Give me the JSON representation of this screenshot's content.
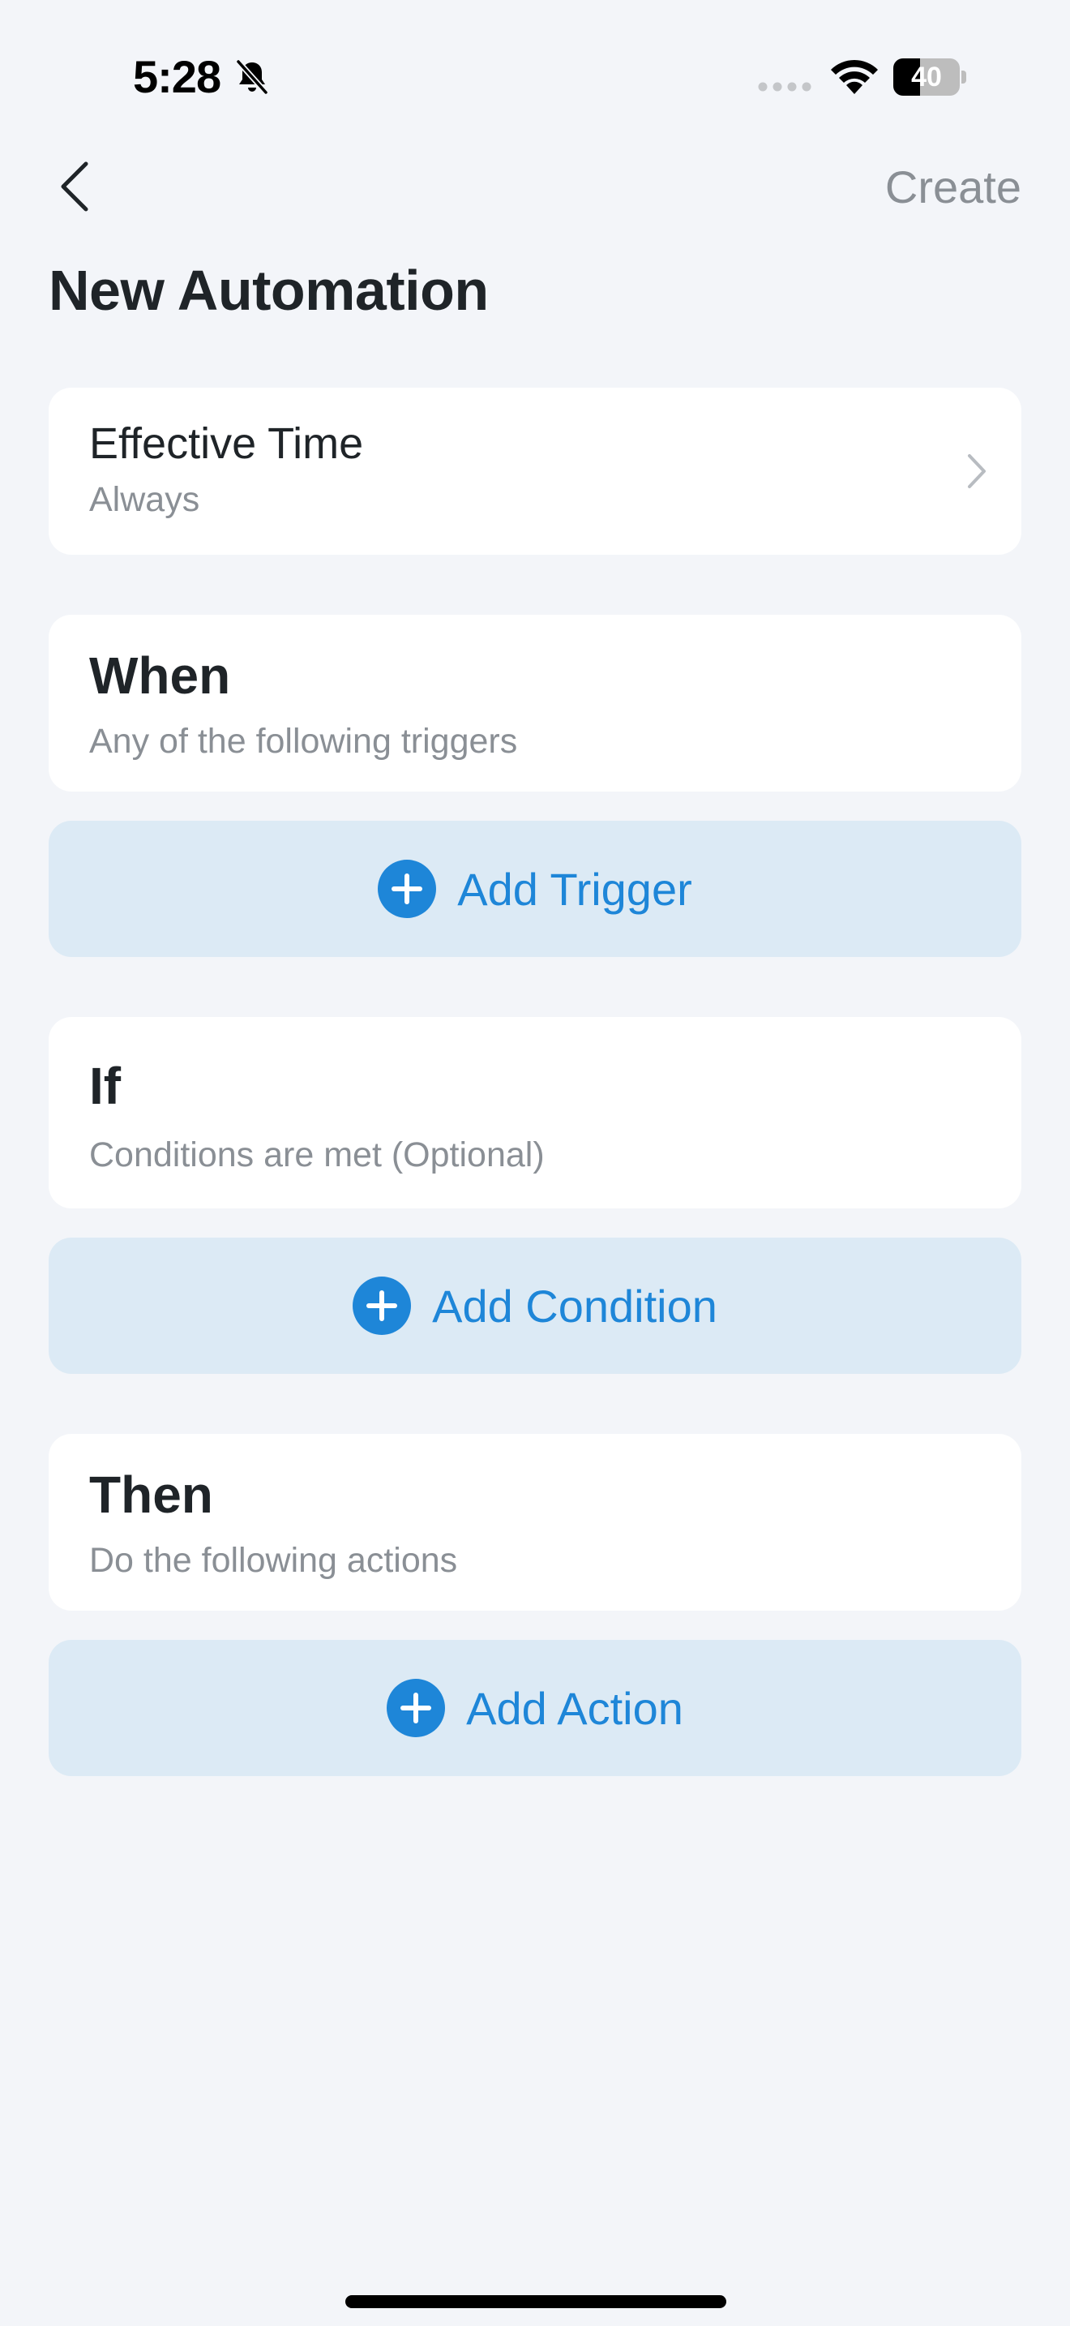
{
  "status_bar": {
    "time": "5:28",
    "battery_level": "40",
    "battery_fraction": 0.4,
    "icons": [
      "bell-slash-icon",
      "cellular-signal-icon",
      "wifi-icon",
      "battery-icon"
    ]
  },
  "nav": {
    "back_icon": "chevron-left-icon",
    "create_label": "Create"
  },
  "page": {
    "title": "New Automation"
  },
  "effective_time": {
    "title": "Effective Time",
    "value": "Always",
    "icon": "chevron-right-icon"
  },
  "sections": {
    "when": {
      "title": "When",
      "subtitle": "Any of the following triggers",
      "button_label": "Add Trigger"
    },
    "if": {
      "title": "If",
      "subtitle": "Conditions are met (Optional)",
      "button_label": "Add Condition"
    },
    "then": {
      "title": "Then",
      "subtitle": "Do the following actions",
      "button_label": "Add Action"
    }
  },
  "colors": {
    "background": "#f3f5f9",
    "card": "#ffffff",
    "accent": "#1e86d8",
    "button_bg": "#dceaf5",
    "muted_text": "#8a8f95",
    "primary_text": "#1f2428"
  }
}
